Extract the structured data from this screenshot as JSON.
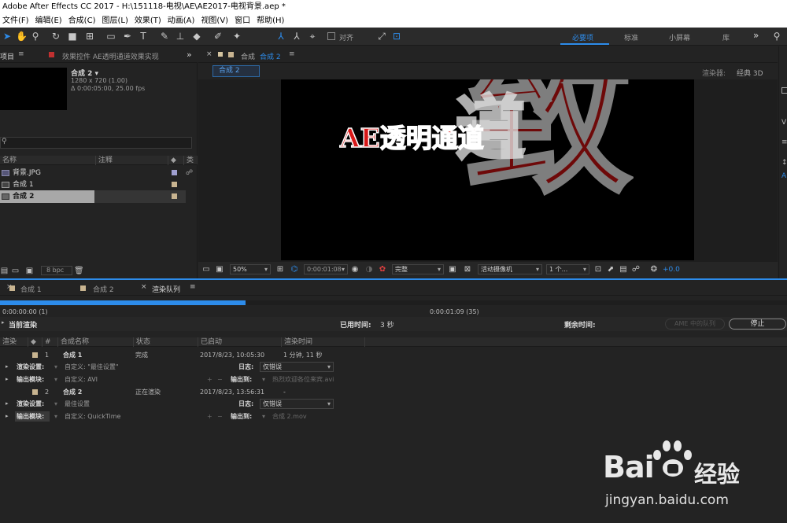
{
  "app": {
    "title": "Adobe After Effects CC 2017 - H:\\151118-电视\\AE\\AE2017-电视背景.aep *"
  },
  "menu": [
    "文件(F)",
    "编辑(E)",
    "合成(C)",
    "图层(L)",
    "效果(T)",
    "动画(A)",
    "视图(V)",
    "窗口",
    "帮助(H)"
  ],
  "toolbar": {
    "align_label": "对齐",
    "workspaces": [
      "必要项",
      "标准",
      "小屏幕",
      "库"
    ],
    "active_workspace": "必要项",
    "more": "»"
  },
  "project_panel": {
    "tab_label": "项目",
    "effects_tab_label": "效果控件 AE透明通道效果实现",
    "preview_name": "合成 2 ▾",
    "preview_info1": "1280 x 720 (1.00)",
    "preview_info2": "Δ 0:00:05:00, 25.00 fps",
    "search_placeholder": "",
    "columns": [
      "名称",
      "注释",
      "类"
    ],
    "items": [
      {
        "name": "背景.JPG",
        "swatch": "#a0a0d0",
        "selected": false
      },
      {
        "name": "合成 1",
        "swatch": "#c8b490",
        "selected": false
      },
      {
        "name": "合成 2",
        "swatch": "#c8b490",
        "selected": true
      }
    ],
    "bpc": "8 bpc"
  },
  "composition_panel": {
    "tab_label": "合成",
    "tab_comp": "合成 2",
    "breadcrumb": "合成 2",
    "renderer_label": "渲染器:",
    "renderer_value": "经典 3D",
    "canvas": {
      "title_text": "AE透明通道",
      "bg_text": "致",
      "ghost_text": "道"
    },
    "footer": {
      "zoom": "50%",
      "timecode": "0:00:01:08",
      "quality": "完整",
      "camera": "活动摄像机",
      "views": "1 个...",
      "exposure": "+0.0"
    }
  },
  "right_strip": {
    "letters": [
      "V",
      "A"
    ]
  },
  "timeline_tabs": [
    {
      "label": "合成 1",
      "active": false
    },
    {
      "label": "合成 2",
      "active": false
    },
    {
      "label": "渲染队列",
      "active": true
    }
  ],
  "render_queue": {
    "progress": 0.312,
    "time_start": "0:00:00:00 (1)",
    "time_current": "0:00:01:09 (35)",
    "current_render_label": "当前渲染",
    "elapsed_label": "已用时间:",
    "elapsed_value": "3 秒",
    "remaining_label": "剩余时间:",
    "ame_button": "AME 中的队列",
    "stop_button": "停止",
    "columns": [
      "渲染",
      "#",
      "合成名称",
      "状态",
      "已启动",
      "渲染时间"
    ],
    "items": [
      {
        "index": "1",
        "comp": "合成 1",
        "status": "完成",
        "started": "2017/8/23, 10:05:30",
        "render_time": "1 分钟, 11 秒",
        "render_settings_label": "渲染设置:",
        "render_settings_value": "自定义: \"最佳设置\"",
        "log_label": "日志:",
        "log_value": "仅错误",
        "output_module_label": "输出模块:",
        "output_module_value": "自定义: AVI",
        "output_to_label": "输出到:",
        "output_to_value": "热烈欢迎各位来宾.avi"
      },
      {
        "index": "2",
        "comp": "合成 2",
        "status": "正在渲染",
        "started": "2017/8/23, 13:56:31",
        "render_time": "-",
        "render_settings_label": "渲染设置:",
        "render_settings_value": "最佳设置",
        "log_label": "日志:",
        "log_value": "仅错误",
        "output_module_label": "输出模块:",
        "output_module_value": "自定义: QuickTime",
        "output_to_label": "输出到:",
        "output_to_value": "合成 2.mov"
      }
    ]
  },
  "watermark": {
    "brand": "Bai",
    "brand2": "经验",
    "url": "jingyan.baidu.com"
  },
  "colors": {
    "accent": "#2d8ceb",
    "comp_red": "#d81818"
  }
}
